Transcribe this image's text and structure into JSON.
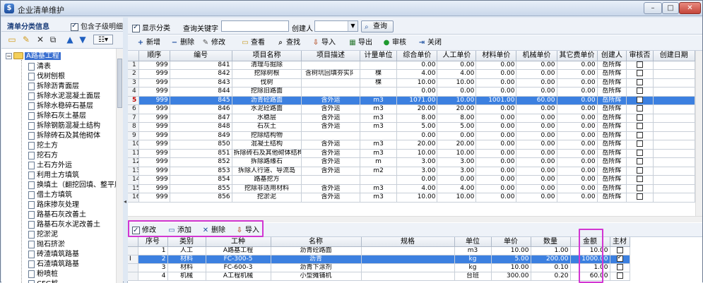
{
  "window": {
    "title": "企业清单维护",
    "minimize": "–",
    "maximize": "□",
    "close": "✕"
  },
  "left": {
    "header": "清单分类信息",
    "include_sub_label": "包含子级明细",
    "include_sub_checked": true,
    "root_toggle": "−",
    "root_label": "A路基工程",
    "items": [
      "清表",
      "伐树刨根",
      "拆除沥青面层",
      "拆除水泥混凝土面层",
      "拆除水稳碎石基层",
      "拆除石灰土基层",
      "拆除钢筋混凝土结构",
      "拆除砖石及其他砌体",
      "挖土方",
      "挖石方",
      "土石方外运",
      "利用土方填筑",
      "换填土（翻挖回填、整平压",
      "借土方填筑",
      "路床掺灰处理",
      "路基石灰改善土",
      "路基石灰水泥改善土",
      "挖淤泥",
      "抛石挤淤",
      "砖渣填筑路基",
      "石渣填筑路基",
      "粉喷桩",
      "CFG桩"
    ]
  },
  "filter": {
    "show_category_label": "显示分类",
    "show_category_checked": true,
    "keyword_label": "查询关键字",
    "keyword_value": "",
    "creator_label": "创建人",
    "creator_value": "",
    "query_button": "查询"
  },
  "toolbar": [
    {
      "icon": "+",
      "label": "新增",
      "color": "#1f4fa0"
    },
    {
      "icon": "−",
      "label": "删除",
      "color": "#1f4fa0"
    },
    {
      "icon": "✎",
      "label": "修改",
      "color": "#555"
    },
    {
      "icon": "▭",
      "label": "查看",
      "color": "#c89a22"
    },
    {
      "icon": "⌕",
      "label": "查找",
      "color": "#333"
    },
    {
      "icon": "⇩",
      "label": "导入",
      "color": "#b5522a"
    },
    {
      "icon": "▦",
      "label": "导出",
      "color": "#2f7a35"
    },
    {
      "icon": "●",
      "label": "审核",
      "color": "#1f9a2f"
    },
    {
      "icon": "⇥",
      "label": "关闭",
      "color": "#2f5ea8"
    }
  ],
  "table1": {
    "columns": [
      "顺序",
      "编号",
      "项目名称",
      "项目描述",
      "计量单位",
      "综合单价",
      "人工单价",
      "材料单价",
      "机械单价",
      "其它费单价",
      "创建人",
      "审核否",
      "创建日期"
    ],
    "rows": [
      {
        "n": "1",
        "seq": "999",
        "code": "841",
        "name": "清理与掘除",
        "desc": "",
        "unit": "",
        "total": "0.00",
        "labor": "0.00",
        "mat": "0.00",
        "mach": "0.00",
        "other": "0.00",
        "creator": "岳所辉"
      },
      {
        "n": "2",
        "seq": "999",
        "code": "842",
        "name": "挖除树根",
        "desc": "含树坑回填夯实阝",
        "unit": "棵",
        "total": "4.00",
        "labor": "4.00",
        "mat": "0.00",
        "mach": "0.00",
        "other": "0.00",
        "creator": "岳所辉"
      },
      {
        "n": "3",
        "seq": "999",
        "code": "843",
        "name": "伐树",
        "desc": "",
        "unit": "棵",
        "total": "10.00",
        "labor": "10.00",
        "mat": "0.00",
        "mach": "0.00",
        "other": "0.00",
        "creator": "岳所辉"
      },
      {
        "n": "4",
        "seq": "999",
        "code": "844",
        "name": "挖除旧路面",
        "desc": "",
        "unit": "",
        "total": "0.00",
        "labor": "0.00",
        "mat": "0.00",
        "mach": "0.00",
        "other": "0.00",
        "creator": "岳所辉"
      },
      {
        "n": "5",
        "seq": "999",
        "code": "845",
        "name": "沥青砼路面",
        "desc": "含外运",
        "unit": "m3",
        "total": "1071.00",
        "labor": "10.00",
        "mat": "1001.00",
        "mach": "60.00",
        "other": "0.00",
        "creator": "岳所辉",
        "selected": true
      },
      {
        "n": "6",
        "seq": "999",
        "code": "846",
        "name": "水泥砼路面",
        "desc": "含外运",
        "unit": "m3",
        "total": "20.00",
        "labor": "20.00",
        "mat": "0.00",
        "mach": "0.00",
        "other": "0.00",
        "creator": "岳所辉"
      },
      {
        "n": "7",
        "seq": "999",
        "code": "847",
        "name": "水稳层",
        "desc": "含外运",
        "unit": "m3",
        "total": "8.00",
        "labor": "8.00",
        "mat": "0.00",
        "mach": "0.00",
        "other": "0.00",
        "creator": "岳所辉"
      },
      {
        "n": "8",
        "seq": "999",
        "code": "848",
        "name": "石灰土",
        "desc": "含外运",
        "unit": "m3",
        "total": "5.00",
        "labor": "5.00",
        "mat": "0.00",
        "mach": "0.00",
        "other": "0.00",
        "creator": "岳所辉"
      },
      {
        "n": "9",
        "seq": "999",
        "code": "849",
        "name": "挖除结构物",
        "desc": "",
        "unit": "",
        "total": "0.00",
        "labor": "0.00",
        "mat": "0.00",
        "mach": "0.00",
        "other": "0.00",
        "creator": "岳所辉"
      },
      {
        "n": "10",
        "seq": "999",
        "code": "850",
        "name": "混凝土结构",
        "desc": "含外运",
        "unit": "m3",
        "total": "20.00",
        "labor": "20.00",
        "mat": "0.00",
        "mach": "0.00",
        "other": "0.00",
        "creator": "岳所辉"
      },
      {
        "n": "11",
        "seq": "999",
        "code": "851",
        "name": "拆除砖石及其他砌体结构",
        "desc": "含外运",
        "unit": "m3",
        "total": "10.00",
        "labor": "10.00",
        "mat": "0.00",
        "mach": "0.00",
        "other": "0.00",
        "creator": "岳所辉"
      },
      {
        "n": "12",
        "seq": "999",
        "code": "852",
        "name": "拆除路缘石",
        "desc": "含外运",
        "unit": "m",
        "total": "3.00",
        "labor": "3.00",
        "mat": "0.00",
        "mach": "0.00",
        "other": "0.00",
        "creator": "岳所辉"
      },
      {
        "n": "13",
        "seq": "999",
        "code": "853",
        "name": "拆除人行道、导流岛",
        "desc": "含外运",
        "unit": "m2",
        "total": "3.00",
        "labor": "3.00",
        "mat": "0.00",
        "mach": "0.00",
        "other": "0.00",
        "creator": "岳所辉"
      },
      {
        "n": "14",
        "seq": "999",
        "code": "854",
        "name": "路基挖方",
        "desc": "",
        "unit": "",
        "total": "0.00",
        "labor": "0.00",
        "mat": "0.00",
        "mach": "0.00",
        "other": "0.00",
        "creator": "岳所辉"
      },
      {
        "n": "15",
        "seq": "999",
        "code": "855",
        "name": "挖除非适用材料",
        "desc": "含外运",
        "unit": "m3",
        "total": "4.00",
        "labor": "4.00",
        "mat": "0.00",
        "mach": "0.00",
        "other": "0.00",
        "creator": "岳所辉"
      },
      {
        "n": "16",
        "seq": "999",
        "code": "856",
        "name": "挖淤泥",
        "desc": "含外运",
        "unit": "m3",
        "total": "10.00",
        "labor": "10.00",
        "mat": "0.00",
        "mach": "0.00",
        "other": "0.00",
        "creator": "岳所辉"
      }
    ]
  },
  "subtoolbar": {
    "edit_label": "修改",
    "edit_checked": true,
    "add_label": "添加",
    "delete_label": "删除",
    "import_label": "导入"
  },
  "table2": {
    "columns": [
      "序号",
      "类别",
      "工种",
      "名称",
      "规格",
      "单位",
      "单价",
      "数量",
      "金额",
      "主材"
    ],
    "rows": [
      {
        "n": "1",
        "cat": "人工",
        "code": "A路基工程",
        "name": "沥青砼路面",
        "spec": "",
        "unit": "m3",
        "price": "10.00",
        "qty": "1.00",
        "amount": "10.00",
        "main": false
      },
      {
        "n": "2",
        "cat": "材料",
        "code": "FC-300-5",
        "name": "沥青",
        "spec": "",
        "unit": "kg",
        "price": "5.00",
        "qty": "200.00",
        "amount": "1000.00",
        "main": true,
        "selected": true
      },
      {
        "n": "3",
        "cat": "材料",
        "code": "FC-600-3",
        "name": "沥青下涂剂",
        "spec": "",
        "unit": "kg",
        "price": "10.00",
        "qty": "0.10",
        "amount": "1.00",
        "main": false
      },
      {
        "n": "4",
        "cat": "机械",
        "code": "A工程机械",
        "name": "小型摊铺机",
        "spec": "",
        "unit": "台班",
        "price": "300.00",
        "qty": "0.20",
        "amount": "60.00",
        "main": false
      }
    ]
  },
  "colors": {
    "selection": "#3c80e0",
    "highlight_box": "#d236d2",
    "selected_row_number": "#c00000"
  }
}
